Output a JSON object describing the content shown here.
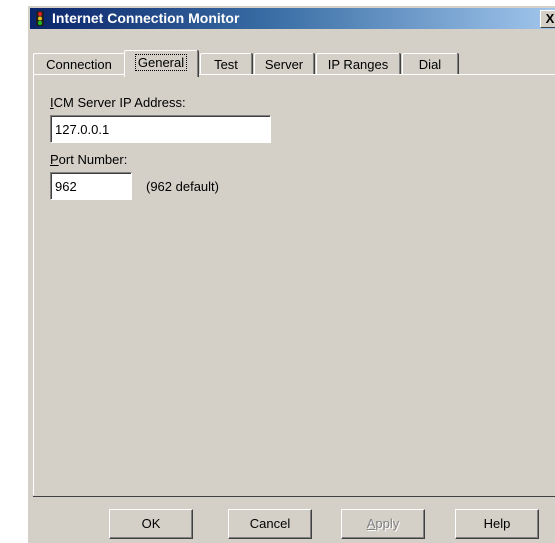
{
  "window": {
    "title": "Internet Connection Monitor",
    "close_glyph": "X",
    "icon": "traffic-light-icon"
  },
  "tabs": [
    {
      "label": "Connection"
    },
    {
      "label": "General",
      "active": true
    },
    {
      "label": "Test"
    },
    {
      "label": "Server"
    },
    {
      "label": "IP Ranges"
    },
    {
      "label": "Dial"
    }
  ],
  "general": {
    "server_ip_label_accel": "I",
    "server_ip_label_rest": "CM Server IP Address:",
    "server_ip_value": "127.0.0.1",
    "port_label_accel": "P",
    "port_label_rest": "ort Number:",
    "port_value": "962",
    "port_hint": "(962 default)"
  },
  "buttons": {
    "ok": "OK",
    "cancel": "Cancel",
    "apply_accel": "A",
    "apply_rest": "pply",
    "help": "Help"
  }
}
